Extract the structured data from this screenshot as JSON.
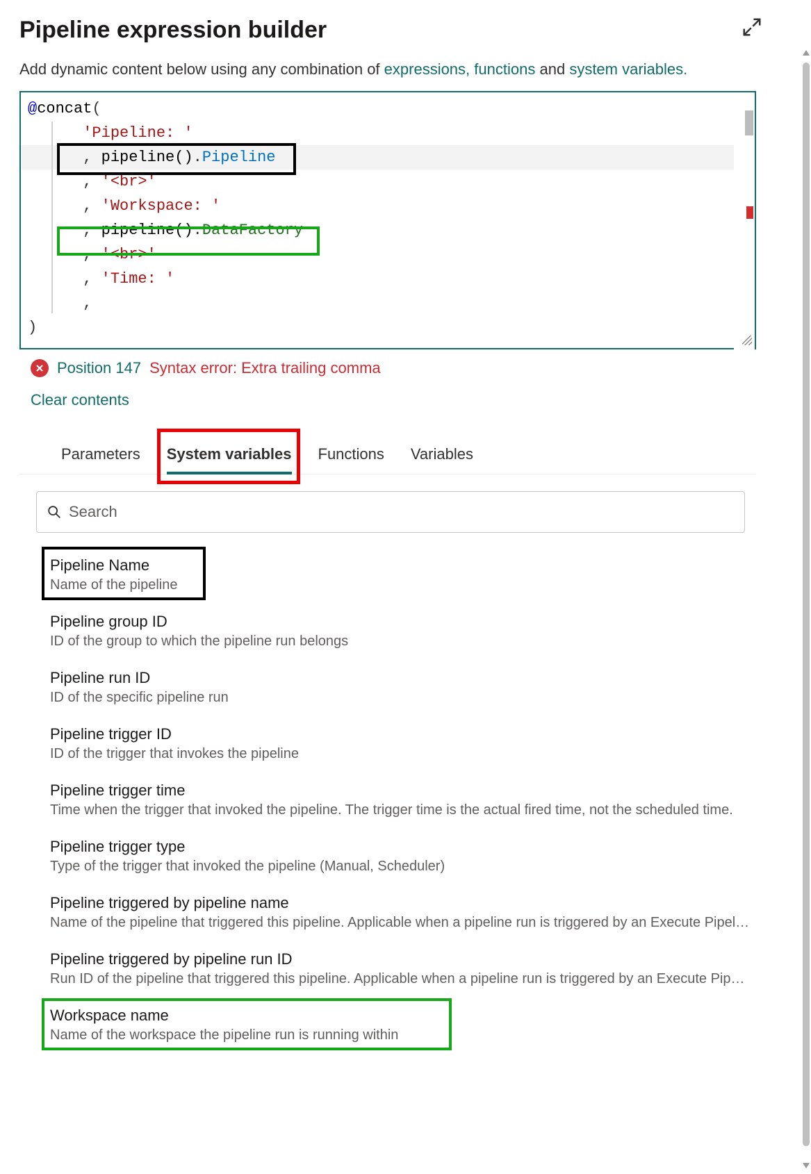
{
  "header": {
    "title": "Pipeline expression builder"
  },
  "intro": {
    "prefix": "Add dynamic content below using any combination of ",
    "link_expr": "expressions,",
    "link_func": "functions",
    "mid": " and ",
    "link_sys": "system variables.",
    "period": ""
  },
  "editor": {
    "lines": [
      {
        "at": "@",
        "fn": "concat",
        "paren": "("
      },
      {
        "str": "'Pipeline: '"
      },
      {
        "comma": ", ",
        "call": "pipeline()",
        "dot": ".",
        "prop_blue": "Pipeline"
      },
      {
        "comma": ", ",
        "str": "'<br>'"
      },
      {
        "comma": ", ",
        "str": "'Workspace: '"
      },
      {
        "comma": ", ",
        "call": "pipeline()",
        "dot": ".",
        "prop_green": "DataFactory"
      },
      {
        "comma": ", ",
        "str": "'<br>'"
      },
      {
        "comma": ", ",
        "str": "'Time: '"
      },
      {
        "comma": ","
      },
      {
        "paren_close": ")"
      }
    ]
  },
  "error": {
    "position_label": "Position 147",
    "message": "Syntax error: Extra trailing comma"
  },
  "clear_label": "Clear contents",
  "tabs": {
    "items": [
      {
        "label": "Parameters"
      },
      {
        "label": "System variables"
      },
      {
        "label": "Functions"
      },
      {
        "label": "Variables"
      }
    ],
    "active_index": 1
  },
  "search": {
    "placeholder": "Search"
  },
  "sysvars": [
    {
      "title": "Pipeline Name",
      "desc": "Name of the pipeline"
    },
    {
      "title": "Pipeline group ID",
      "desc": "ID of the group to which the pipeline run belongs"
    },
    {
      "title": "Pipeline run ID",
      "desc": "ID of the specific pipeline run"
    },
    {
      "title": "Pipeline trigger ID",
      "desc": "ID of the trigger that invokes the pipeline"
    },
    {
      "title": "Pipeline trigger time",
      "desc": "Time when the trigger that invoked the pipeline. The trigger time is the actual fired time, not the scheduled time."
    },
    {
      "title": "Pipeline trigger type",
      "desc": "Type of the trigger that invoked the pipeline (Manual, Scheduler)"
    },
    {
      "title": "Pipeline triggered by pipeline name",
      "desc": "Name of the pipeline that triggered this pipeline. Applicable when a pipeline run is triggered by an Execute Pipeline activity."
    },
    {
      "title": "Pipeline triggered by pipeline run ID",
      "desc": "Run ID of the pipeline that triggered this pipeline. Applicable when a pipeline run is triggered by an Execute Pipeline activity."
    },
    {
      "title": "Workspace name",
      "desc": "Name of the workspace the pipeline run is running within"
    }
  ],
  "annotations": {
    "tab_red_box": true,
    "item_black_index": 0,
    "item_green_index": 8
  }
}
